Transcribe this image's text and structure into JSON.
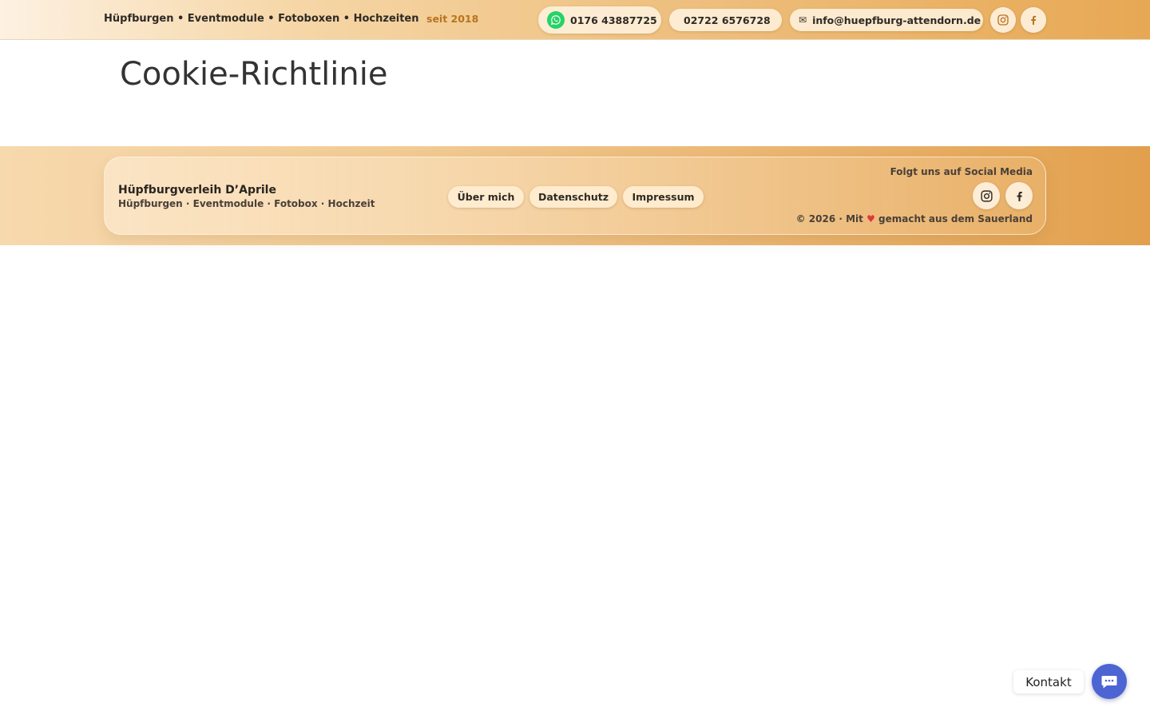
{
  "topbar": {
    "tagline": "Hüpfburgen • Eventmodule • Fotoboxen • Hochzeiten",
    "since": "seit 2018",
    "whatsapp_number": "0176 43887725",
    "phone_glyph": "",
    "phone_number": "02722 6576728",
    "mail_glyph": "✉",
    "email": "info@huepfburg-attendorn.de",
    "icons": {
      "whatsapp": "whatsapp-icon",
      "instagram": "instagram-icon",
      "facebook": "facebook-icon"
    }
  },
  "main": {
    "title": "Cookie-Richtlinie"
  },
  "footer": {
    "brand_name": "Hüpfburgverleih D’Aprile",
    "brand_sub": "Hüpfburgen · Eventmodule · Fotobox · Hochzeit",
    "links": [
      "Über mich",
      "Datenschutz",
      "Impressum"
    ],
    "social_label": "Folgt uns auf Social Media",
    "copyright_pre": "© 2026 · Mit",
    "heart": "♥",
    "copyright_post": "gemacht aus dem Sauerland"
  },
  "contact": {
    "label": "Kontakt",
    "icon": "chat-bubble-icon"
  },
  "colors": {
    "accent": "#e7a854",
    "since_text": "#b7741e",
    "whatsapp": "#25d366",
    "contact_button": "#4d64d3",
    "heart": "#e0363c"
  }
}
